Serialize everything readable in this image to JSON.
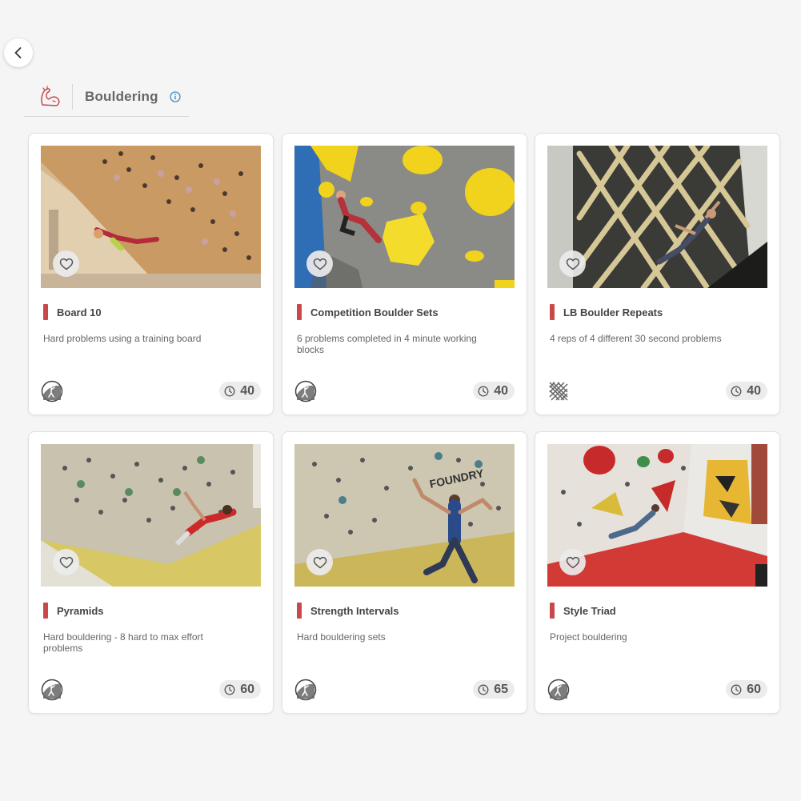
{
  "header": {
    "title": "Bouldering",
    "category_icon": "flexed-arm-icon",
    "info_icon": "info-icon",
    "accent_color": "#c9494a"
  },
  "cards": [
    {
      "name": "Board 10",
      "description": "Hard problems using a training board",
      "duration": "40",
      "type_icon": "climber-icon"
    },
    {
      "name": "Competition Boulder Sets",
      "description": "6 problems completed in 4 minute working blocks",
      "duration": "40",
      "type_icon": "climber-icon"
    },
    {
      "name": "LB Boulder Repeats",
      "description": "4 reps of 4 different 30 second problems",
      "duration": "40",
      "type_icon": "lattice-board-icon"
    },
    {
      "name": "Pyramids",
      "description": "Hard bouldering - 8 hard to max effort problems",
      "duration": "60",
      "type_icon": "climber-icon"
    },
    {
      "name": "Strength Intervals",
      "description": "Hard bouldering sets",
      "duration": "65",
      "type_icon": "climber-icon"
    },
    {
      "name": "Style Triad",
      "description": "Project bouldering",
      "duration": "60",
      "type_icon": "climber-icon"
    }
  ]
}
